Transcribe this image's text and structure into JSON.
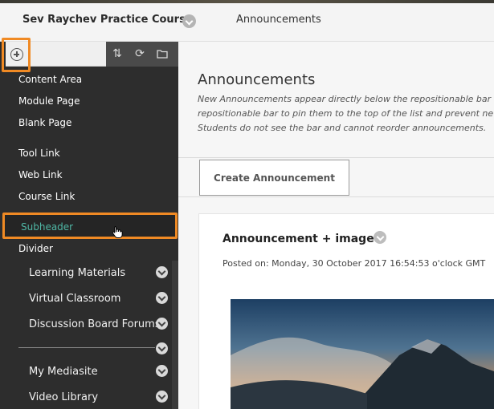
{
  "header": {
    "course_title": "Sev Raychev Practice Course",
    "breadcrumb": "Announcements"
  },
  "toolbar": {
    "add_icon": "plus-circle-icon",
    "sort_icon": "sort-arrows-icon",
    "refresh_icon": "refresh-icon",
    "folder_icon": "folder-icon"
  },
  "add_menu": {
    "items": [
      "Content Area",
      "Module Page",
      "Blank Page",
      "Tool Link",
      "Web Link",
      "Course Link",
      "Subheader",
      "Divider"
    ]
  },
  "course_menu": {
    "items": [
      "Learning Materials",
      "Virtual Classroom",
      "Discussion Board Forums",
      "My Mediasite",
      "Video Library"
    ]
  },
  "main": {
    "heading": "Announcements",
    "description": [
      "New Announcements appear directly below the repositionable bar",
      "repositionable bar to pin them to the top of the list and prevent ne",
      "Students do not see the bar and cannot reorder announcements."
    ],
    "create_button": "Create Announcement",
    "announcement": {
      "title": "Announcement + image",
      "posted": "Posted on: Monday, 30 October 2017 16:54:53 o'clock GMT"
    }
  },
  "colors": {
    "highlight": "#f08a24",
    "subheader_text": "#4fb7a5",
    "sidebar_bg": "#2d2d2d"
  }
}
